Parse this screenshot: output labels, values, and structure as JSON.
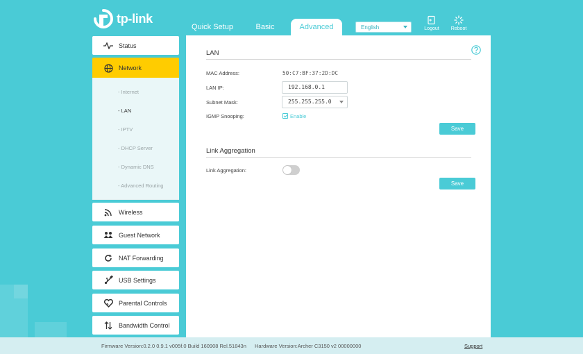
{
  "header": {
    "brand": "tp-link",
    "tabs": [
      "Quick Setup",
      "Basic",
      "Advanced"
    ],
    "active_tab": "Advanced",
    "language": "English",
    "logout_label": "Logout",
    "reboot_label": "Reboot"
  },
  "sidebar": {
    "items": [
      {
        "label": "Status",
        "icon": "pulse-icon"
      },
      {
        "label": "Network",
        "icon": "globe-icon",
        "active": true
      },
      {
        "label": "Wireless",
        "icon": "wifi-icon"
      },
      {
        "label": "Guest Network",
        "icon": "users-icon"
      },
      {
        "label": "NAT Forwarding",
        "icon": "refresh-icon"
      },
      {
        "label": "USB Settings",
        "icon": "usb-icon"
      },
      {
        "label": "Parental Controls",
        "icon": "heart-icon"
      },
      {
        "label": "Bandwidth Control",
        "icon": "arrows-icon"
      }
    ],
    "subitems": [
      "- Internet",
      "- LAN",
      "- IPTV",
      "- DHCP Server",
      "- Dynamic DNS",
      "- Advanced Routing"
    ],
    "current_sub": "- LAN"
  },
  "lan": {
    "title": "LAN",
    "mac_label": "MAC Address:",
    "mac_value": "50:C7:BF:37:2D:DC",
    "ip_label": "LAN IP:",
    "ip_value": "192.168.0.1",
    "mask_label": "Subnet Mask:",
    "mask_value": "255.255.255.0",
    "igmp_label": "IGMP Snooping:",
    "igmp_enable_label": "Enable",
    "igmp_enabled": true,
    "save_label": "Save"
  },
  "link_aggregation": {
    "title": "Link Aggregation",
    "label": "Link Aggregation:",
    "enabled": false,
    "save_label": "Save"
  },
  "footer": {
    "firmware": "Firmware Version:0.2.0 0.9.1 v005f.0 Build 160908 Rel.51843n",
    "hardware": "Hardware Version:Archer C3150 v2 00000000",
    "support": "Support"
  },
  "colors": {
    "accent": "#4acbd6",
    "active_nav": "#ffcc00"
  }
}
